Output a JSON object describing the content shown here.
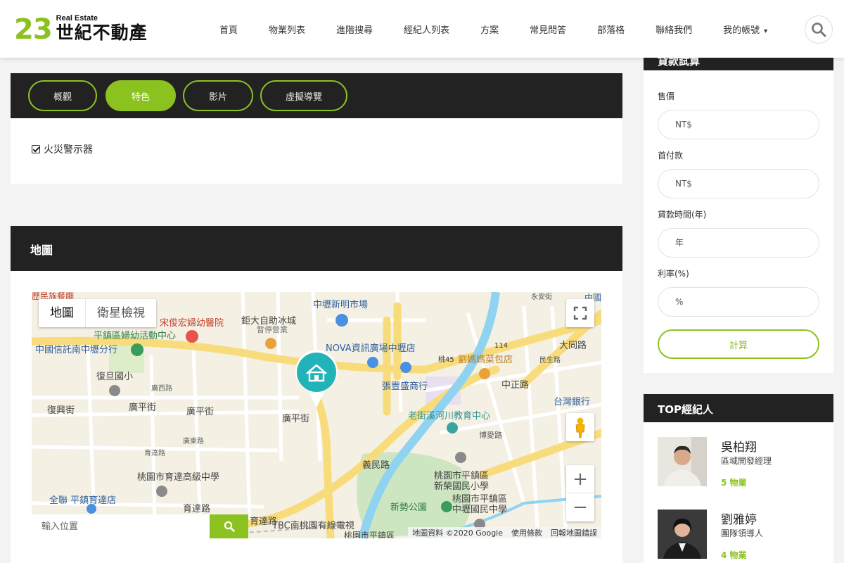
{
  "header": {
    "logo_number": "23",
    "logo_small": "Real Estate",
    "logo_brand": "世紀不動產",
    "nav": [
      "首頁",
      "物業列表",
      "進階搜尋",
      "經紀人列表",
      "方案",
      "常見問答",
      "部落格",
      "聯絡我們",
      "我的帳號"
    ],
    "accent_color": "#8cc21f"
  },
  "tabs": [
    {
      "label": "概觀",
      "active": false
    },
    {
      "label": "特色",
      "active": true
    },
    {
      "label": "影片",
      "active": false
    },
    {
      "label": "虛擬導覽",
      "active": false
    }
  ],
  "features": [
    "火災警示器"
  ],
  "map_section": {
    "title": "地圖",
    "map_type_map": "地圖",
    "map_type_satellite": "衛星檢視",
    "search_placeholder": "輸入位置",
    "attribution": [
      "地圖資料 ©2020 Google",
      "使用條款",
      "回報地圖錯誤"
    ],
    "labels": {
      "l1": "歷民族餐廳",
      "l2": "宋俊宏婦幼醫院",
      "l3": "平鎮區婦幼活動中心",
      "l4": "中國信託南中壢分行",
      "l5": "復旦國小",
      "l6": "復興街",
      "l7": "廣平街",
      "l8": "廣平街",
      "l9": "廣平街",
      "l10": "中壢新明市場",
      "l11": "鉅大自助冰城",
      "l12": "暫停營業",
      "l13": "NOVA資訊廣場中壢店",
      "l14": "張豐盛商行",
      "l15": "劉媽媽菜包店",
      "l16": "老街溪河川教育中心",
      "l17": "中正路",
      "l18": "台灣銀行",
      "l19": "大同路",
      "l20": "桃園市育達高級中學",
      "l21": "全聯 平鎮育達店",
      "l22": "育達路",
      "l23": "育達路",
      "l24": "義民路",
      "l25": "桃園市平鎮區",
      "l26": "新榮國民小學",
      "l27": "新勢公園",
      "l28": "桃園市平鎮區",
      "l29": "中壢國民中學",
      "l30": "TBC南桃園有線電視",
      "l31": "桃園市平鎮區",
      "l32": "114",
      "l33": "桃45",
      "l34": "博愛路",
      "l35": "永安街",
      "l36": "民生路",
      "l37": "中國",
      "l38": "廣西路",
      "l39": "廣東路",
      "l40": "育達路"
    }
  },
  "loan": {
    "title": "貸款試算",
    "fields": [
      {
        "label": "售價",
        "placeholder": "NT$"
      },
      {
        "label": "首付款",
        "placeholder": "NT$"
      },
      {
        "label": "貸款時間(年)",
        "placeholder": "年"
      },
      {
        "label": "利率(%)",
        "placeholder": "%"
      }
    ],
    "button": "計算"
  },
  "agents": {
    "title": "TOP經紀人",
    "list": [
      {
        "name": "吳柏翔",
        "role": "區域開發經理",
        "count": "5 物業"
      },
      {
        "name": "劉雅婷",
        "role": "團隊領導人",
        "count": "4 物業"
      }
    ]
  }
}
